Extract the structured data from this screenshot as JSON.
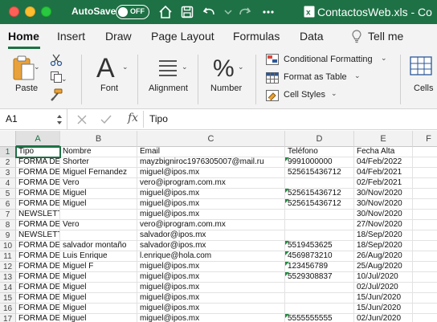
{
  "titlebar": {
    "autosave_label": "AutoSave",
    "toggle_state": "OFF",
    "document_title": "ContactosWeb.xls  -  Co",
    "icons": [
      "home-icon",
      "save-icon",
      "undo-icon",
      "redo-icon",
      "more-icon"
    ]
  },
  "tabs": [
    "Home",
    "Insert",
    "Draw",
    "Page Layout",
    "Formulas",
    "Data",
    "Tell me"
  ],
  "ribbon": {
    "paste": "Paste",
    "font": "Font",
    "alignment": "Alignment",
    "number": "Number",
    "conditional_formatting": "Conditional Formatting",
    "format_as_table": "Format as Table",
    "cell_styles": "Cell Styles",
    "cells": "Cells"
  },
  "formula_bar": {
    "name_box": "A1",
    "fx": "fx",
    "content": "Tipo"
  },
  "columns": [
    "A",
    "B",
    "C",
    "D",
    "E",
    "F"
  ],
  "rows": [
    {
      "n": "1",
      "a": "Tipo",
      "b": "Nombre",
      "c": "Email",
      "d": "Teléfono",
      "e": "Fecha Alta",
      "tri": false
    },
    {
      "n": "2",
      "a": "FORMA DE",
      "b": "Shorter",
      "c": "mayzbigniroc1976305007@mail.ru",
      "d": "9991000000",
      "e": "04/Feb/2022",
      "tri": true
    },
    {
      "n": "3",
      "a": "FORMA DE",
      "b": "Miguel Fernandez",
      "c": "miguel@ipos.mx",
      "d": "525615436712",
      "e": "04/Feb/2021",
      "tri": false
    },
    {
      "n": "4",
      "a": "FORMA DE",
      "b": "Vero",
      "c": "vero@iprogram.com.mx",
      "d": "",
      "e": "02/Feb/2021",
      "tri": false
    },
    {
      "n": "5",
      "a": "FORMA DE",
      "b": "Miguel",
      "c": "miguel@ipos.mx",
      "d": "525615436712",
      "e": "30/Nov/2020",
      "tri": true
    },
    {
      "n": "6",
      "a": "FORMA DE",
      "b": "Miguel",
      "c": "miguel@ipos.mx",
      "d": "525615436712",
      "e": "30/Nov/2020",
      "tri": true
    },
    {
      "n": "7",
      "a": "NEWSLETTER",
      "b": "",
      "c": "miguel@ipos.mx",
      "d": "",
      "e": "30/Nov/2020",
      "tri": false
    },
    {
      "n": "8",
      "a": "FORMA DE",
      "b": "Vero",
      "c": "vero@iprogram.com.mx",
      "d": "",
      "e": "27/Nov/2020",
      "tri": false
    },
    {
      "n": "9",
      "a": "NEWSLETTER",
      "b": "",
      "c": "salvador@ipos.mx",
      "d": "",
      "e": "18/Sep/2020",
      "tri": false
    },
    {
      "n": "10",
      "a": "FORMA DE",
      "b": "salvador montaño",
      "c": "salvador@ipos.mx",
      "d": "5519453625",
      "e": "18/Sep/2020",
      "tri": true
    },
    {
      "n": "11",
      "a": "FORMA DE",
      "b": "Luis Enrique",
      "c": "l.enrique@hola.com",
      "d": "4569873210",
      "e": "26/Aug/2020",
      "tri": true
    },
    {
      "n": "12",
      "a": "FORMA DE",
      "b": "Miguel F",
      "c": "miguel@ipos.mx",
      "d": "123456789",
      "e": "25/Aug/2020",
      "tri": true
    },
    {
      "n": "13",
      "a": "FORMA DE",
      "b": "Miguel",
      "c": "miguel@ipos.mx",
      "d": "5529308837",
      "e": "10/Jul/2020",
      "tri": true
    },
    {
      "n": "14",
      "a": "FORMA DE",
      "b": "Miguel",
      "c": "miguel@ipos.mx",
      "d": "",
      "e": "02/Jul/2020",
      "tri": false
    },
    {
      "n": "15",
      "a": "FORMA DE",
      "b": "Miguel",
      "c": "miguel@ipos.mx",
      "d": "",
      "e": "15/Jun/2020",
      "tri": false
    },
    {
      "n": "16",
      "a": "FORMA DE",
      "b": "Miguel",
      "c": "miguel@ipos.mx",
      "d": "",
      "e": "15/Jun/2020",
      "tri": false
    },
    {
      "n": "17",
      "a": "FORMA DE",
      "b": "Miguel",
      "c": "miguel@ipos.mx",
      "d": "5555555555",
      "e": "02/Jun/2020",
      "tri": true
    }
  ],
  "colors": {
    "accent": "#1e7145",
    "text_triangle": "#1e8e3e"
  }
}
